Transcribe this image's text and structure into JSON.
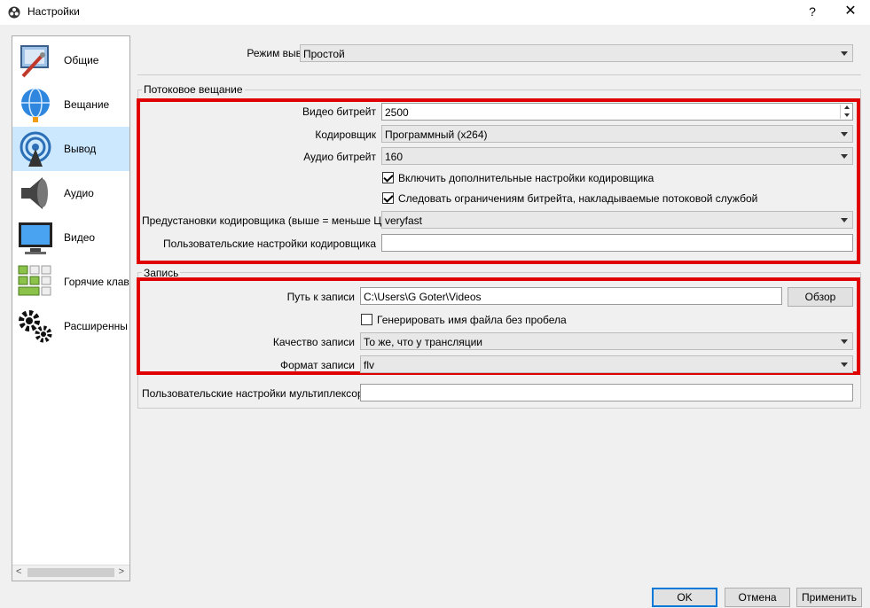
{
  "window": {
    "title": "Настройки",
    "help_glyph": "?",
    "close_glyph": "✕"
  },
  "sidebar": {
    "items": [
      {
        "label": "Общие",
        "icon": "general-icon"
      },
      {
        "label": "Вещание",
        "icon": "broadcast-globe-icon"
      },
      {
        "label": "Вывод",
        "icon": "output-antenna-icon"
      },
      {
        "label": "Аудио",
        "icon": "speaker-icon"
      },
      {
        "label": "Видео",
        "icon": "monitor-icon"
      },
      {
        "label": "Горячие клав",
        "icon": "keyboard-icon"
      },
      {
        "label": "Расширенны",
        "icon": "gears-icon"
      }
    ],
    "active": "Вывод",
    "scroll_left": "<",
    "scroll_right": ">"
  },
  "output_mode": {
    "label": "Режим вывода",
    "value": "Простой"
  },
  "streaming": {
    "title": "Потоковое вещание",
    "video_bitrate": {
      "label": "Видео битрейт",
      "value": "2500"
    },
    "encoder": {
      "label": "Кодировщик",
      "value": "Программный (x264)"
    },
    "audio_bitrate": {
      "label": "Аудио битрейт",
      "value": "160"
    },
    "advanced_encoder": {
      "label": "Включить дополнительные настройки кодировщика",
      "checked": true
    },
    "enforce_limits": {
      "label": "Следовать ограничениям битрейта, накладываемые потоковой службой",
      "checked": true
    },
    "preset": {
      "label": "Предустановки кодировщика (выше = меньше ЦП)",
      "value": "veryfast"
    },
    "custom_settings": {
      "label": "Пользовательские настройки кодировщика",
      "value": ""
    }
  },
  "recording": {
    "title": "Запись",
    "path": {
      "label": "Путь к записи",
      "value": "C:\\Users\\G Goter\\Videos"
    },
    "browse_label": "Обзор",
    "no_space": {
      "label": "Генерировать имя файла без пробела",
      "checked": false
    },
    "quality": {
      "label": "Качество записи",
      "value": "То же, что у трансляции"
    },
    "format": {
      "label": "Формат записи",
      "value": "flv"
    },
    "muxer": {
      "label": "Пользовательские настройки мультиплексора",
      "value": ""
    }
  },
  "buttons": {
    "ok": "OK",
    "cancel": "Отмена",
    "apply": "Применить"
  },
  "colors": {
    "highlight": "#e00000",
    "selection": "#cce8ff",
    "default_button": "#0078d7"
  }
}
